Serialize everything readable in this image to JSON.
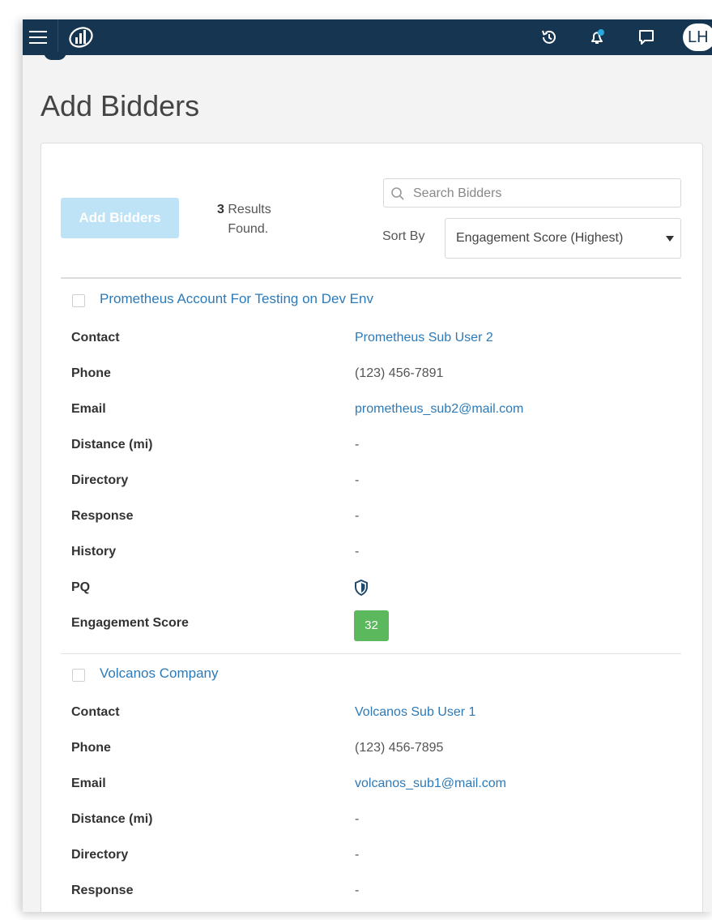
{
  "header": {
    "menu_icon": "hamburger-icon",
    "logo_icon": "bar-chart-logo-icon",
    "history_icon": "history-icon",
    "notification_icon": "bell-icon",
    "message_icon": "chat-bubble-icon",
    "avatar_initials": "LH",
    "bar_color": "#163550",
    "notification_dot_color": "#29a8e0"
  },
  "page": {
    "title": "Add Bidders"
  },
  "toolbar": {
    "add_button_label": "Add Bidders",
    "results_count": "3",
    "results_text": "Results Found.",
    "search_placeholder": "Search Bidders",
    "search_icon": "search-icon",
    "sort_label": "Sort By",
    "sort_value": "Engagement Score (Highest)",
    "button_color": "#bfe3f6"
  },
  "field_labels": {
    "contact": "Contact",
    "phone": "Phone",
    "email": "Email",
    "distance": "Distance (mi)",
    "directory": "Directory",
    "response": "Response",
    "history": "History",
    "pq": "PQ",
    "engagement_score": "Engagement Score"
  },
  "bidders": [
    {
      "name": "Prometheus Account For Testing on Dev Env",
      "contact": "Prometheus Sub User 2",
      "phone": "(123) 456-7891",
      "email": "prometheus_sub2@mail.com",
      "distance": "-",
      "directory": "-",
      "response": "-",
      "history": "-",
      "pq_icon": "shield-icon",
      "engagement_score": "32",
      "score_color": "#5cb85c"
    },
    {
      "name": "Volcanos Company",
      "contact": "Volcanos Sub User 1",
      "phone": "(123) 456-7895",
      "email": "volcanos_sub1@mail.com",
      "distance": "-",
      "directory": "-",
      "response": "-"
    }
  ]
}
